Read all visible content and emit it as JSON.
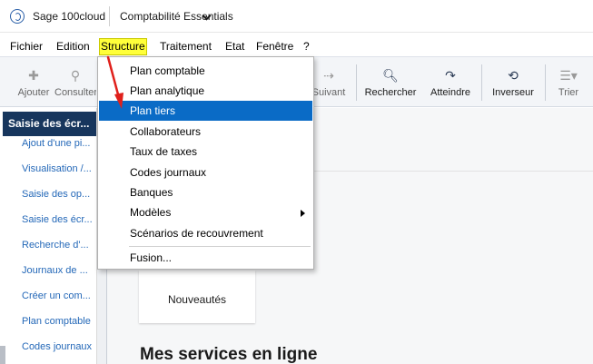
{
  "titlebar": {
    "app_name": "Sage 100cloud",
    "company": "Comptabilité Essentials"
  },
  "menubar": {
    "items": [
      "Fichier",
      "Edition",
      "Structure",
      "Traitement",
      "Etat",
      "Fenêtre",
      "?"
    ],
    "active": "Structure"
  },
  "toolbar": {
    "buttons": [
      {
        "label": "Ajouter",
        "icon": "plus-icon",
        "enabled": false
      },
      {
        "label": "Consulter",
        "icon": "search-icon",
        "enabled": false
      },
      {
        "label": "Suivant",
        "icon": "arrow-right-icon",
        "enabled": false
      },
      {
        "label": "Rechercher",
        "icon": "search-icon",
        "enabled": true
      },
      {
        "label": "Atteindre",
        "icon": "redo-icon",
        "enabled": true
      },
      {
        "label": "Inverseur",
        "icon": "refresh-icon",
        "enabled": true
      },
      {
        "label": "Trier",
        "icon": "sort-icon",
        "enabled": false
      }
    ]
  },
  "sidebar": {
    "header": "Saisie des écr...",
    "items": [
      "Ajout d'une pi...",
      "Visualisation /...",
      "Saisie des op...",
      "Saisie des écr...",
      "Recherche d'...",
      "Journaux de ...",
      "Créer un com...",
      "Plan comptable",
      "Codes journaux"
    ]
  },
  "main": {
    "card_label": "Nouveautés",
    "services_title": "Mes services en ligne"
  },
  "structure_menu": {
    "items": [
      "Plan comptable",
      "Plan analytique",
      "Plan tiers",
      "Collaborateurs",
      "Taux de taxes",
      "Codes journaux",
      "Banques",
      "Modèles",
      "Scénarios de recouvrement",
      "Fusion..."
    ],
    "selected": "Plan tiers",
    "has_submenu": "Modèles"
  },
  "colors": {
    "highlight_menu": "#ffff3a",
    "selection": "#0a6bc6",
    "sidebar_header": "#17365d",
    "link": "#2468b8",
    "annotation_arrow": "#e0201b"
  }
}
